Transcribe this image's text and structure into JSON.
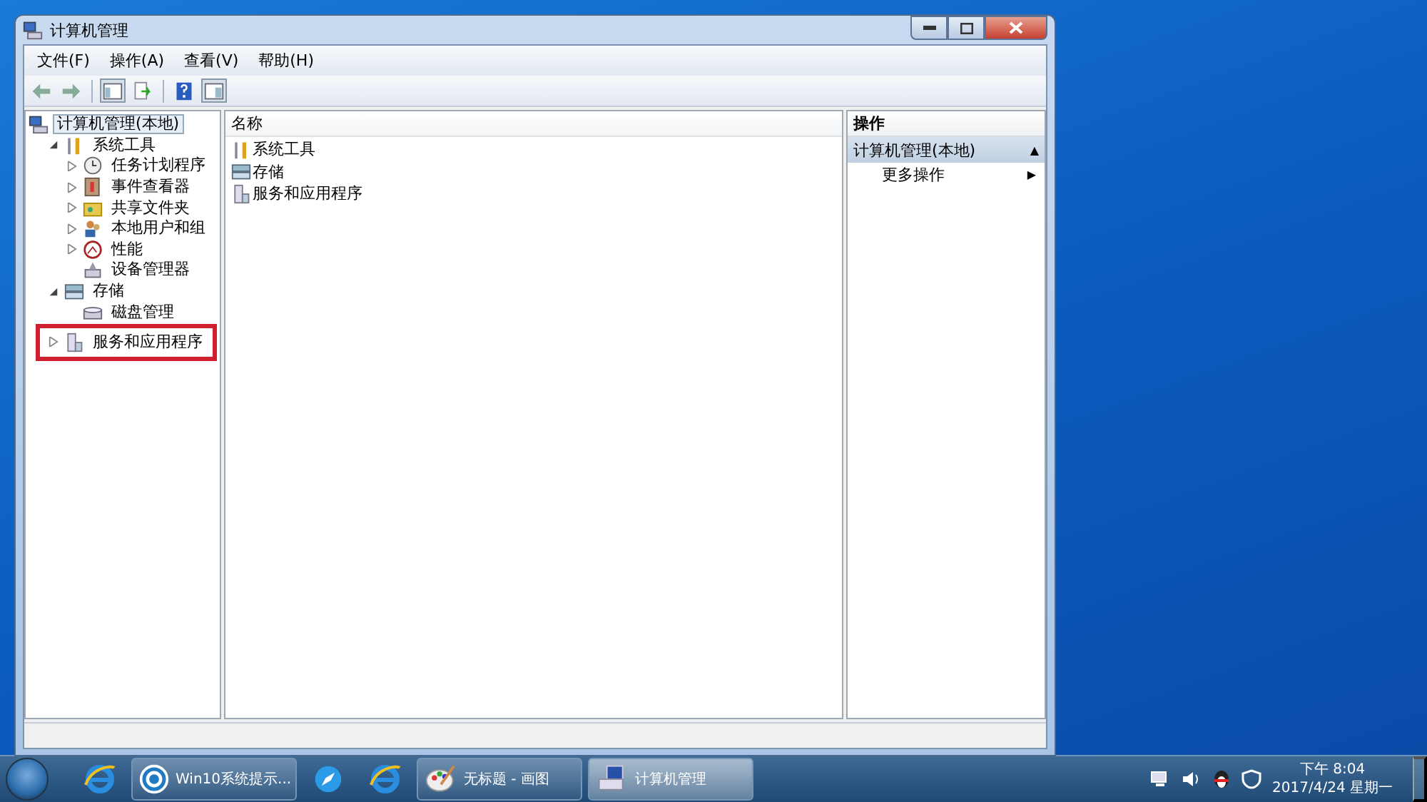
{
  "window": {
    "title": "计算机管理"
  },
  "menu": [
    "文件(F)",
    "操作(A)",
    "查看(V)",
    "帮助(H)"
  ],
  "toolbar": [
    {
      "kind": "back"
    },
    {
      "kind": "forward"
    },
    {
      "kind": "sep"
    },
    {
      "kind": "tree",
      "pressed": true
    },
    {
      "kind": "export",
      "pressed": false
    },
    {
      "kind": "sep"
    },
    {
      "kind": "help",
      "pressed": false
    },
    {
      "kind": "actions",
      "pressed": true
    }
  ],
  "tree": [
    {
      "label": "计算机管理(本地)",
      "kind": "root",
      "selected": true,
      "highlighted": false,
      "children": [
        {
          "label": "系统工具",
          "kind": "branch",
          "expanded": true,
          "selected": false,
          "highlighted": false,
          "children": [
            {
              "label": "任务计划程序",
              "kind": "branch",
              "expanded": false,
              "selected": false,
              "highlighted": false
            },
            {
              "label": "事件查看器",
              "kind": "branch",
              "expanded": false,
              "selected": false,
              "highlighted": false
            },
            {
              "label": "共享文件夹",
              "kind": "branch",
              "expanded": false,
              "selected": false,
              "highlighted": false
            },
            {
              "label": "本地用户和组",
              "kind": "branch",
              "expanded": false,
              "selected": false,
              "highlighted": false
            },
            {
              "label": "性能",
              "kind": "branch",
              "expanded": false,
              "selected": false,
              "highlighted": false
            },
            {
              "label": "设备管理器",
              "kind": "leaf",
              "selected": false,
              "highlighted": false
            }
          ]
        },
        {
          "label": "存储",
          "kind": "branch",
          "expanded": true,
          "selected": false,
          "highlighted": false,
          "children": [
            {
              "label": "磁盘管理",
              "kind": "leaf",
              "selected": false,
              "highlighted": false
            }
          ]
        },
        {
          "label": "服务和应用程序",
          "kind": "branch",
          "expanded": false,
          "selected": false,
          "highlighted": true
        }
      ]
    }
  ],
  "list": {
    "column": "名称",
    "rows": [
      {
        "label": "系统工具"
      },
      {
        "label": "存储"
      },
      {
        "label": "服务和应用程序"
      }
    ]
  },
  "actions": {
    "header": "操作",
    "section": "计算机管理(本地)",
    "section_arrow": "▲",
    "items": [
      {
        "label": "更多操作",
        "arrow": "▶"
      }
    ]
  },
  "taskbar": [
    {
      "kind": "pinned"
    },
    {
      "kind": "task",
      "label": "Win10系统提示...",
      "selected": false
    },
    {
      "kind": "pinned"
    },
    {
      "kind": "pinned"
    },
    {
      "kind": "task",
      "label": "无标题 - 画图",
      "selected": false
    },
    {
      "kind": "task",
      "label": "计算机管理",
      "selected": true
    }
  ],
  "tray": {
    "time": "下午 8:04",
    "date": "2017/4/24 星期一"
  }
}
